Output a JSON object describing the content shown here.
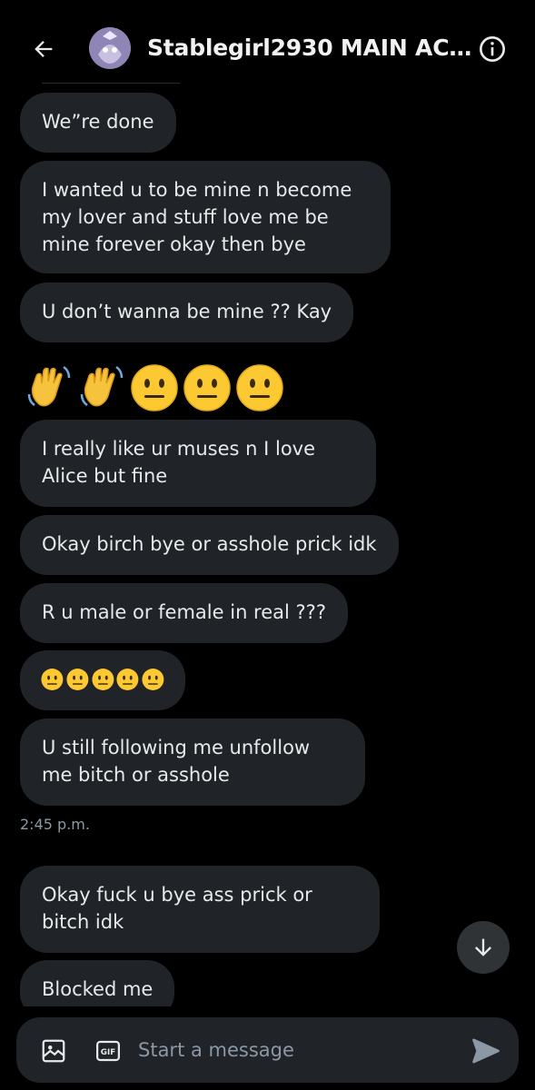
{
  "header": {
    "title": "Stablegirl2930 MAIN ACCO..."
  },
  "messages": [
    {
      "text": "We”re done"
    },
    {
      "text": "I wanted u to be mine n become my lover and stuff love me be mine forever okay then bye"
    },
    {
      "text": "U don’t wanna be mine ?? Kay"
    },
    {
      "emoji": [
        "waving-hand",
        "waving-hand",
        "neutral-face",
        "neutral-face",
        "neutral-face"
      ]
    },
    {
      "text": "I really like ur muses n I love Alice but fine"
    },
    {
      "text": "Okay birch bye or asshole prick idk"
    },
    {
      "text": "R u male or female in real ???"
    },
    {
      "emoji_small": [
        "neutral-face",
        "neutral-face",
        "neutral-face",
        "neutral-face",
        "neutral-face"
      ]
    },
    {
      "text": "U still following me unfollow me bitch or asshole"
    },
    {
      "text": "Okay fuck u bye ass prick or bitch idk"
    },
    {
      "text": "Blocked me"
    }
  ],
  "timestamp": "2:45 p.m.",
  "composer": {
    "placeholder": "Start a message",
    "gif_label": "GIF"
  },
  "colors": {
    "background": "#000000",
    "bubble": "#202327",
    "text": "#e7e9ea",
    "muted": "#8b98a5"
  }
}
